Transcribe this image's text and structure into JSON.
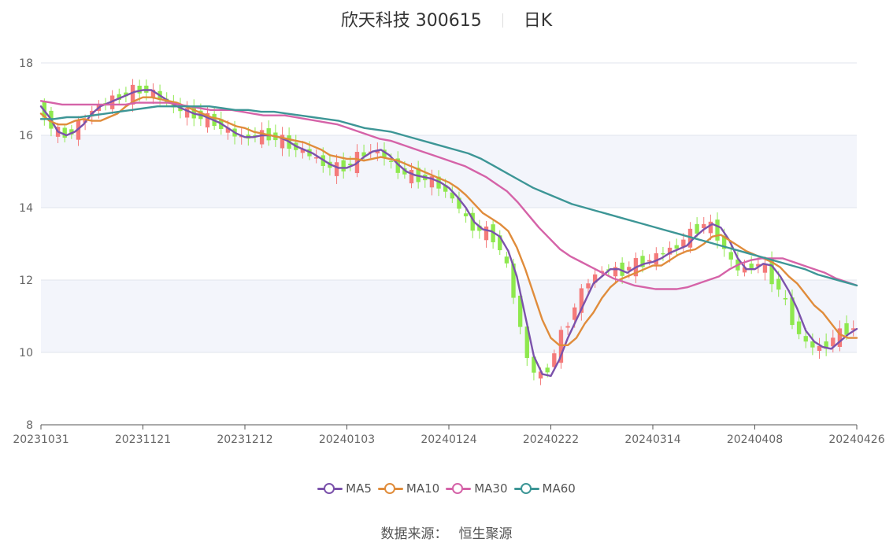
{
  "title": {
    "name": "欣天科技 300615",
    "period": "日K"
  },
  "source": {
    "label": "数据来源：",
    "value": "恒生聚源"
  },
  "colors": {
    "up": "#f47a7a",
    "down": "#8ee84e",
    "grid": "#e2e5ee",
    "band": "#f3f5fb",
    "axis": "#666666"
  },
  "chart_data": {
    "type": "candlestick",
    "ylim": [
      8,
      18
    ],
    "yticks": [
      8,
      10,
      12,
      14,
      16,
      18
    ],
    "xlabels": [
      "20231031",
      "20231121",
      "20231212",
      "20240103",
      "20240124",
      "20240222",
      "20240314",
      "20240408",
      "20240426"
    ],
    "grid": true,
    "legend_position": "bottom",
    "series": [
      {
        "name": "MA5",
        "color": "#7b52ab",
        "values": [
          16.8,
          16.5,
          16.1,
          16.0,
          16.1,
          16.3,
          16.6,
          16.8,
          16.9,
          17.0,
          17.1,
          17.2,
          17.25,
          17.25,
          17.1,
          16.95,
          16.8,
          16.7,
          16.6,
          16.55,
          16.45,
          16.35,
          16.2,
          16.05,
          15.95,
          15.95,
          16.0,
          16.0,
          15.95,
          15.85,
          15.7,
          15.6,
          15.5,
          15.35,
          15.2,
          15.1,
          15.1,
          15.2,
          15.4,
          15.55,
          15.6,
          15.45,
          15.2,
          15.0,
          14.9,
          14.85,
          14.8,
          14.7,
          14.55,
          14.3,
          14.0,
          13.6,
          13.4,
          13.35,
          13.2,
          12.8,
          12.1,
          11.0,
          9.9,
          9.4,
          9.35,
          9.8,
          10.4,
          10.9,
          11.4,
          11.9,
          12.1,
          12.3,
          12.3,
          12.2,
          12.35,
          12.45,
          12.5,
          12.6,
          12.75,
          12.85,
          12.95,
          13.2,
          13.4,
          13.55,
          13.45,
          13.1,
          12.6,
          12.3,
          12.3,
          12.45,
          12.4,
          12.1,
          11.7,
          11.2,
          10.6,
          10.3,
          10.15,
          10.1,
          10.3,
          10.5,
          10.65
        ]
      },
      {
        "name": "MA10",
        "color": "#e08c3b",
        "values": [
          16.6,
          16.4,
          16.3,
          16.3,
          16.4,
          16.45,
          16.4,
          16.4,
          16.5,
          16.6,
          16.8,
          16.95,
          17.05,
          17.05,
          17.0,
          16.95,
          16.9,
          16.8,
          16.7,
          16.6,
          16.5,
          16.45,
          16.35,
          16.25,
          16.2,
          16.1,
          16.05,
          16.0,
          15.95,
          15.9,
          15.85,
          15.8,
          15.7,
          15.6,
          15.45,
          15.4,
          15.35,
          15.35,
          15.3,
          15.35,
          15.4,
          15.35,
          15.3,
          15.2,
          15.1,
          15.0,
          14.9,
          14.8,
          14.7,
          14.55,
          14.35,
          14.1,
          13.85,
          13.7,
          13.55,
          13.35,
          12.9,
          12.3,
          11.6,
          10.9,
          10.4,
          10.2,
          10.2,
          10.4,
          10.8,
          11.1,
          11.5,
          11.8,
          12.0,
          12.1,
          12.2,
          12.3,
          12.4,
          12.4,
          12.55,
          12.7,
          12.8,
          12.85,
          13.0,
          13.2,
          13.25,
          13.1,
          12.95,
          12.8,
          12.7,
          12.6,
          12.5,
          12.35,
          12.1,
          11.9,
          11.6,
          11.3,
          11.1,
          10.8,
          10.5,
          10.4,
          10.4
        ]
      },
      {
        "name": "MA30",
        "color": "#d563a8",
        "values": [
          16.95,
          16.9,
          16.85,
          16.85,
          16.85,
          16.85,
          16.85,
          16.85,
          16.85,
          16.9,
          16.9,
          16.9,
          16.9,
          16.85,
          16.8,
          16.75,
          16.7,
          16.7,
          16.7,
          16.65,
          16.6,
          16.55,
          16.55,
          16.55,
          16.5,
          16.45,
          16.4,
          16.35,
          16.3,
          16.2,
          16.1,
          16.0,
          15.9,
          15.85,
          15.75,
          15.65,
          15.55,
          15.45,
          15.35,
          15.25,
          15.15,
          15.0,
          14.85,
          14.65,
          14.45,
          14.15,
          13.8,
          13.45,
          13.15,
          12.85,
          12.65,
          12.5,
          12.35,
          12.2,
          12.05,
          11.95,
          11.85,
          11.8,
          11.75,
          11.75,
          11.75,
          11.8,
          11.9,
          12.0,
          12.1,
          12.3,
          12.45,
          12.55,
          12.6,
          12.6,
          12.6,
          12.5,
          12.4,
          12.3,
          12.2,
          12.05,
          11.95,
          11.85
        ]
      },
      {
        "name": "MA60",
        "color": "#3d9696",
        "values": [
          16.45,
          16.45,
          16.5,
          16.5,
          16.55,
          16.6,
          16.65,
          16.7,
          16.75,
          16.8,
          16.8,
          16.8,
          16.8,
          16.8,
          16.75,
          16.7,
          16.7,
          16.65,
          16.65,
          16.6,
          16.55,
          16.5,
          16.45,
          16.4,
          16.3,
          16.2,
          16.15,
          16.1,
          16.0,
          15.9,
          15.8,
          15.7,
          15.6,
          15.5,
          15.35,
          15.15,
          14.95,
          14.75,
          14.55,
          14.4,
          14.25,
          14.1,
          14.0,
          13.9,
          13.8,
          13.7,
          13.6,
          13.5,
          13.4,
          13.3,
          13.2,
          13.1,
          13.0,
          12.9,
          12.8,
          12.7,
          12.6,
          12.5,
          12.4,
          12.3,
          12.15,
          12.05,
          11.95,
          11.85
        ]
      }
    ]
  }
}
